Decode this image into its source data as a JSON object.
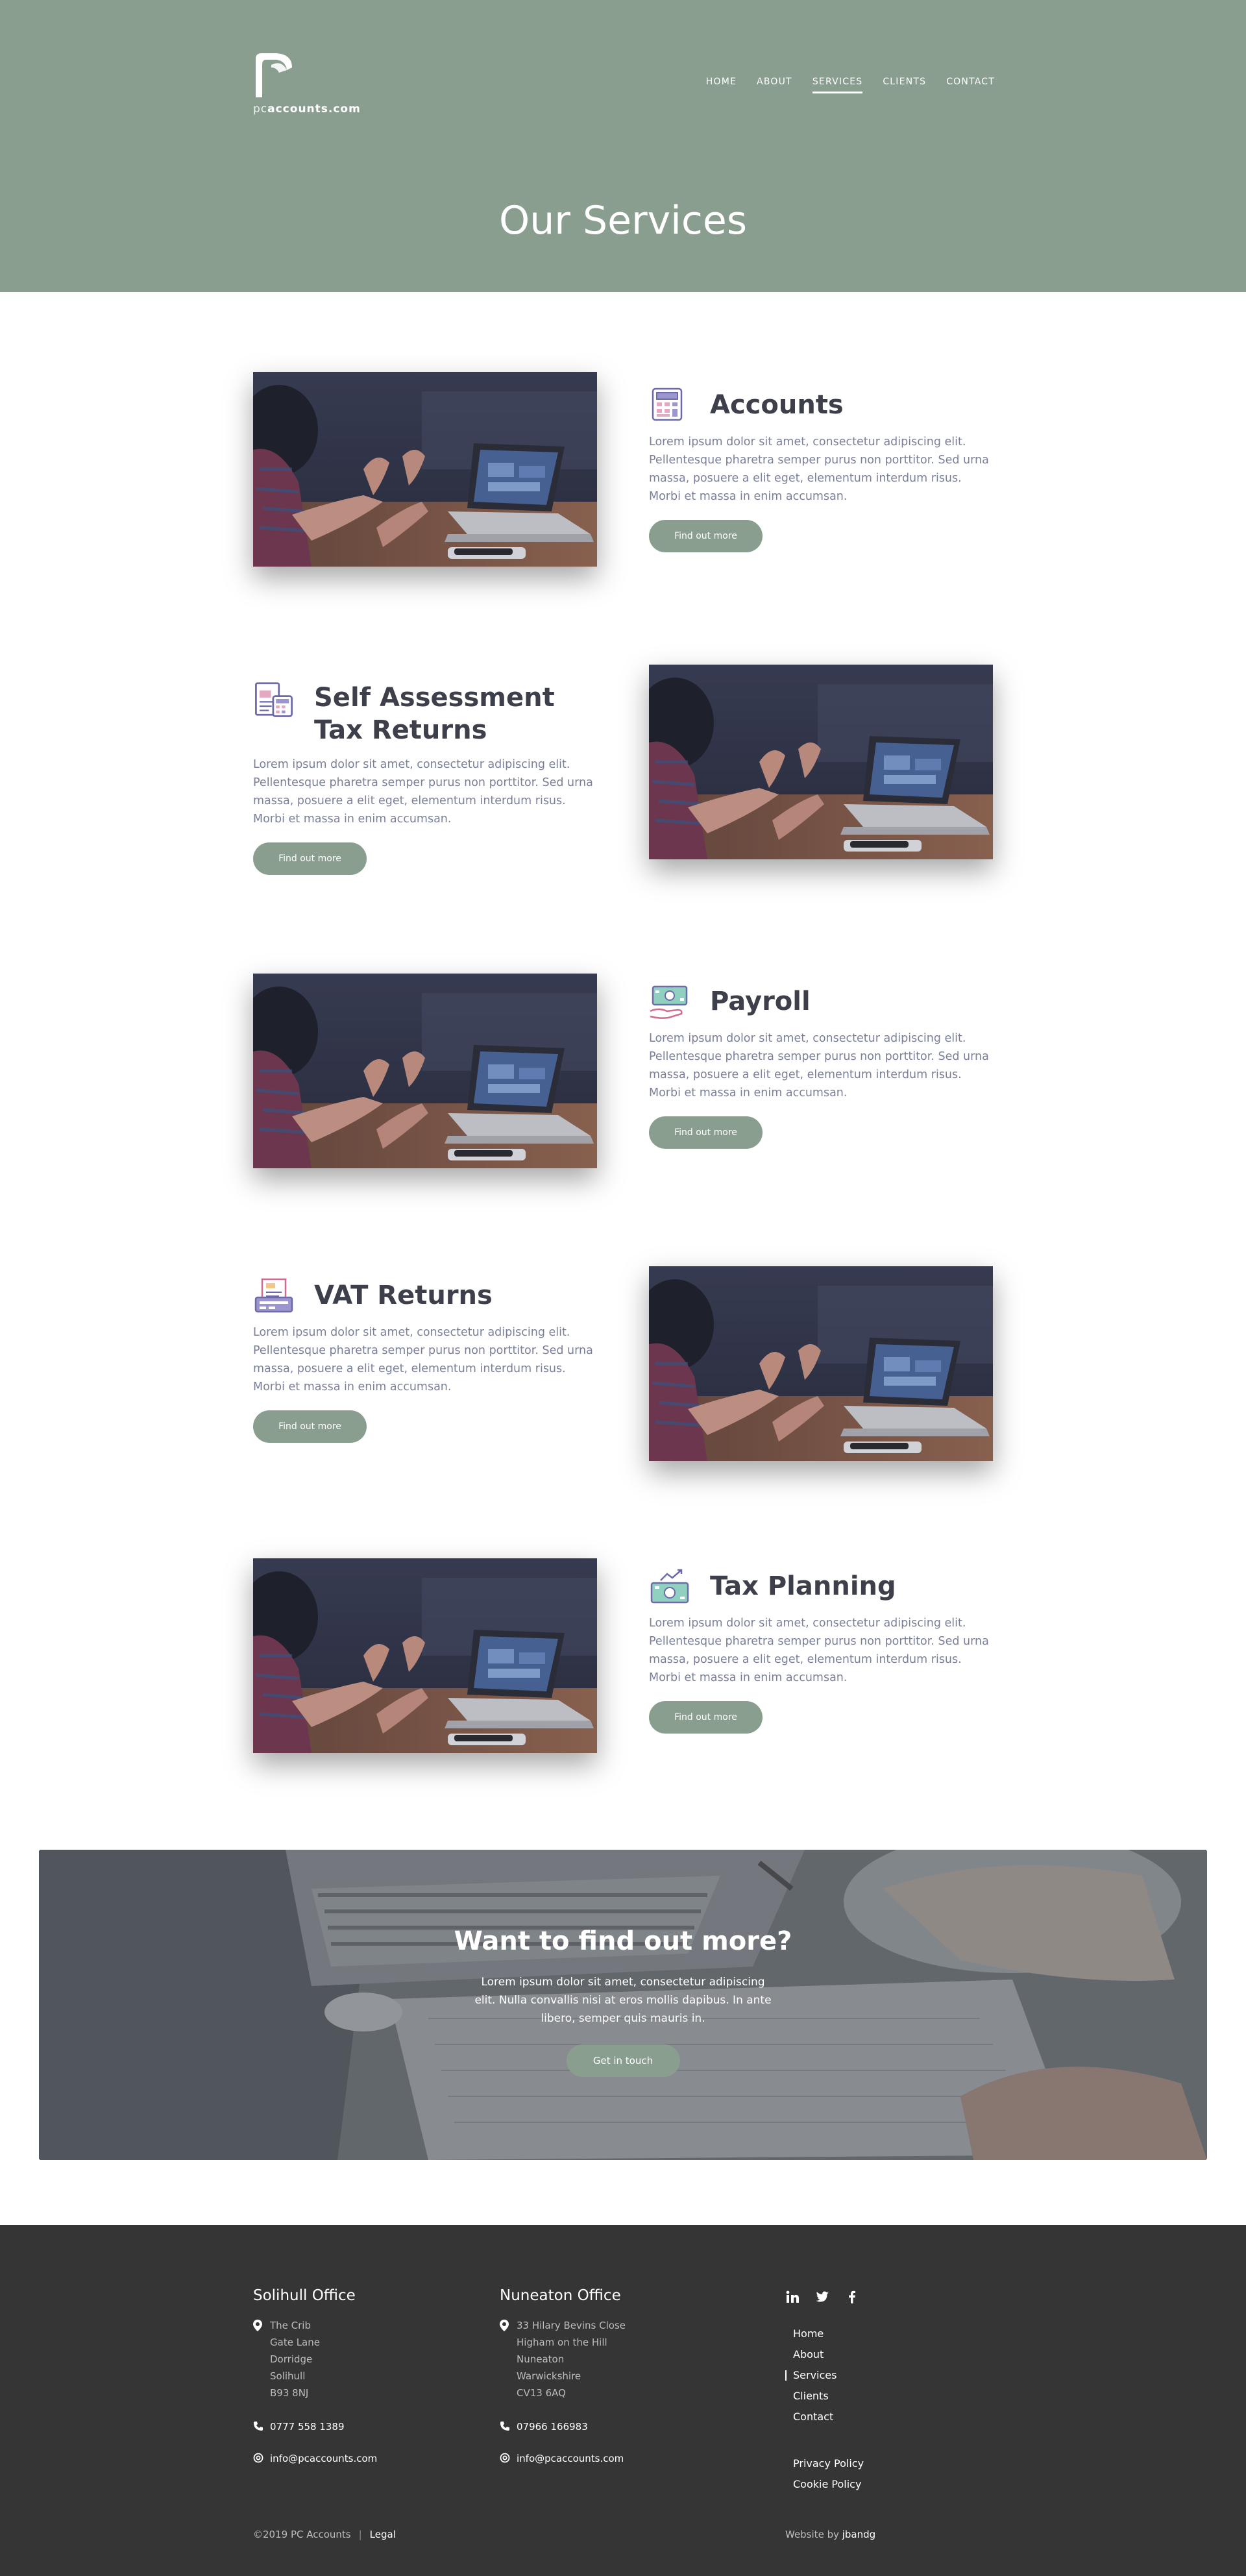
{
  "header": {
    "logo_prefix": "pc",
    "logo_brand": "accounts.com",
    "title": "Our Services",
    "nav": [
      {
        "label": "HOME",
        "active": false
      },
      {
        "label": "ABOUT",
        "active": false
      },
      {
        "label": "SERVICES",
        "active": true
      },
      {
        "label": "CLIENTS",
        "active": false
      },
      {
        "label": "CONTACT",
        "active": false
      }
    ]
  },
  "services": [
    {
      "title": "Accounts",
      "icon": "calculator-icon",
      "body": "Lorem ipsum dolor sit amet, consectetur adipiscing elit. Pellentesque pharetra semper purus non porttitor. Sed urna massa, posuere a elit eget, elementum interdum risus. Morbi et massa in enim accumsan.",
      "button": "Find out more"
    },
    {
      "title": "Self Assessment Tax Returns",
      "icon": "tax-document-icon",
      "body": "Lorem ipsum dolor sit amet, consectetur adipiscing elit. Pellentesque pharetra semper purus non porttitor. Sed urna massa, posuere a elit eget, elementum interdum risus. Morbi et massa in enim accumsan.",
      "button": "Find out more"
    },
    {
      "title": "Payroll",
      "icon": "cash-hand-icon",
      "body": "Lorem ipsum dolor sit amet, consectetur adipiscing elit. Pellentesque pharetra semper purus non porttitor. Sed urna massa, posuere a elit eget, elementum interdum risus. Morbi et massa in enim accumsan.",
      "button": "Find out more"
    },
    {
      "title": "VAT Returns",
      "icon": "receipt-printer-icon",
      "body": "Lorem ipsum dolor sit amet, consectetur adipiscing elit. Pellentesque pharetra semper purus non porttitor. Sed urna massa, posuere a elit eget, elementum interdum risus. Morbi et massa in enim accumsan.",
      "button": "Find out more"
    },
    {
      "title": "Tax Planning",
      "icon": "cash-growth-icon",
      "body": "Lorem ipsum dolor sit amet, consectetur adipiscing elit. Pellentesque pharetra semper purus non porttitor. Sed urna massa, posuere a elit eget, elementum interdum risus. Morbi et massa in enim accumsan.",
      "button": "Find out more"
    }
  ],
  "cta": {
    "title": "Want to find out more?",
    "body": "Lorem ipsum dolor sit amet, consectetur adipiscing elit. Nulla convallis nisi at eros mollis dapibus. In ante libero, semper quis mauris in.",
    "button": "Get in touch"
  },
  "footer": {
    "offices": [
      {
        "name": "Solihull Office",
        "address": [
          "The Crib",
          "Gate Lane",
          "Dorridge",
          "Solihull",
          "B93 8NJ"
        ],
        "phone": "0777 558 1389",
        "email": "info@pcaccounts.com"
      },
      {
        "name": "Nuneaton Office",
        "address": [
          "33 Hilary Bevins Close",
          "Higham on the Hill",
          "Nuneaton",
          "Warwickshire",
          "CV13 6AQ"
        ],
        "phone": "07966 166983",
        "email": "info@pcaccounts.com"
      }
    ],
    "social": [
      "linkedin-icon",
      "twitter-icon",
      "facebook-icon"
    ],
    "links": [
      {
        "label": "Home",
        "active": false
      },
      {
        "label": "About",
        "active": false
      },
      {
        "label": "Services",
        "active": true
      },
      {
        "label": "Clients",
        "active": false
      },
      {
        "label": "Contact",
        "active": false
      }
    ],
    "legal_links": [
      "Privacy Policy",
      "Cookie Policy"
    ],
    "copyright": "©2019 PC Accounts",
    "legal": "Legal",
    "credit_prefix": "Website by ",
    "credit_brand": "jbandg"
  },
  "colors": {
    "brand_green": "#8a9e90",
    "footer_bg": "#353535",
    "heading": "#3d3f4a",
    "body_text": "#7a7f9a"
  }
}
